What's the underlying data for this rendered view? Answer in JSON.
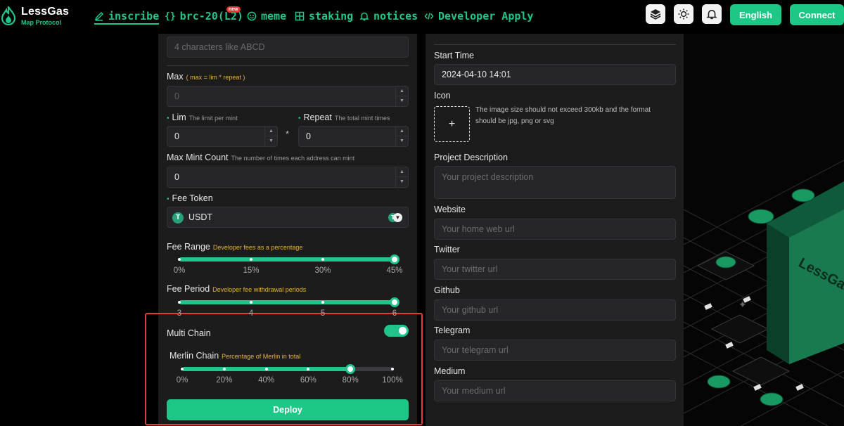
{
  "header": {
    "brand": "LessGas",
    "brand_sub": "Map Protocol",
    "nav": [
      {
        "label": "inscribe",
        "icon": "pen-icon"
      },
      {
        "label": "brc-20(L2)",
        "icon": "braces-icon",
        "badge": "new"
      },
      {
        "label": "meme",
        "icon": "smiley-icon"
      },
      {
        "label": "staking",
        "icon": "grid-icon"
      },
      {
        "label": "notices",
        "icon": "bell-icon"
      },
      {
        "label": "Developer Apply",
        "icon": "code-icon"
      }
    ],
    "language_button": "English",
    "connect_button": "Connect"
  },
  "left_form": {
    "ticker_placeholder": "4 characters like ABCD",
    "max_label": "Max",
    "max_hint": "( max = lim * repeat )",
    "max_value": "0",
    "lim_label": "Lim",
    "lim_hint": "The limit per mint",
    "lim_value": "0",
    "times_sign": "*",
    "repeat_label": "Repeat",
    "repeat_hint": "The total mint times",
    "repeat_value": "0",
    "max_mint_label": "Max Mint Count",
    "max_mint_hint": "The number of times each address can mint",
    "max_mint_value": "0",
    "fee_token_label": "Fee Token",
    "fee_token_value": "USDT",
    "fee_range": {
      "label": "Fee Range",
      "hint": "Developer fees as a percentage",
      "ticks": [
        "0%",
        "15%",
        "30%",
        "45%"
      ],
      "value_fraction": 1.0
    },
    "fee_period": {
      "label": "Fee Period",
      "hint": "Developer fee withdrawal periods",
      "ticks": [
        "3",
        "4",
        "5",
        "6"
      ],
      "value_fraction": 1.0
    },
    "multi_chain_label": "Multi Chain",
    "multi_chain_on": true,
    "merlin": {
      "label": "Merlin Chain",
      "hint": "Percentage of Merlin in total",
      "ticks": [
        "0%",
        "20%",
        "40%",
        "60%",
        "80%",
        "100%"
      ],
      "value_fraction": 0.8
    },
    "deploy_button": "Deploy"
  },
  "right_form": {
    "start_time_label": "Start Time",
    "start_time_value": "2024-04-10 14:01",
    "icon_label": "Icon",
    "upload_plus": "+",
    "icon_hint": "The image size should not exceed 300kb and the format should be jpg, png or svg",
    "description_label": "Project Description",
    "description_placeholder": "Your project description",
    "website_label": "Website",
    "website_placeholder": "Your home web url",
    "twitter_label": "Twitter",
    "twitter_placeholder": "Your twitter url",
    "github_label": "Github",
    "github_placeholder": "Your github url",
    "telegram_label": "Telegram",
    "telegram_placeholder": "Your telegram url",
    "medium_label": "Medium",
    "medium_placeholder": "Your medium url"
  },
  "background_brand": "LessGas",
  "colors": {
    "accent": "#1fc58a",
    "panel": "#1c1c1d",
    "highlight": "#e53935"
  }
}
